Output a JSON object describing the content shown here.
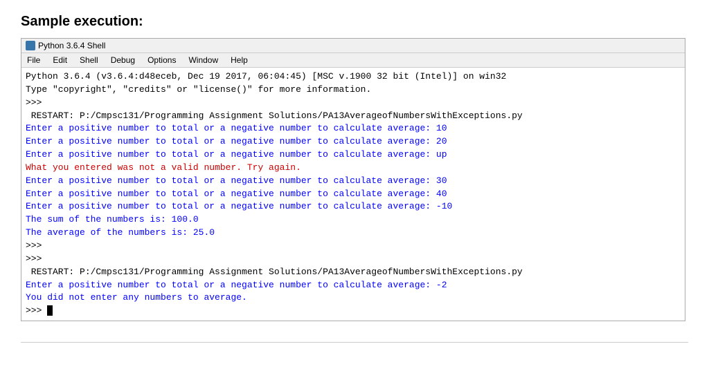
{
  "heading": "Sample execution:",
  "titleBar": {
    "icon": "python-icon",
    "label": "Python 3.6.4 Shell"
  },
  "menuBar": {
    "items": [
      "File",
      "Edit",
      "Shell",
      "Debug",
      "Options",
      "Window",
      "Help"
    ]
  },
  "shellLines": [
    {
      "type": "black",
      "text": "Python 3.6.4 (v3.6.4:d48eceb, Dec 19 2017, 06:04:45) [MSC v.1900 32 bit (Intel)] on win32"
    },
    {
      "type": "black",
      "text": "Type \"copyright\", \"credits\" or \"license()\" for more information."
    },
    {
      "type": "prompt",
      "text": ">>>"
    },
    {
      "type": "restart",
      "text": " RESTART: P:/Cmpsc131/Programming Assignment Solutions/PA13AverageofNumbersWithExceptions.py"
    },
    {
      "type": "blue",
      "text": "Enter a positive number to total or a negative number to calculate average: 10"
    },
    {
      "type": "blue",
      "text": "Enter a positive number to total or a negative number to calculate average: 20"
    },
    {
      "type": "blue",
      "text": "Enter a positive number to total or a negative number to calculate average: up"
    },
    {
      "type": "red",
      "text": "What you entered was not a valid number. Try again."
    },
    {
      "type": "blue",
      "text": "Enter a positive number to total or a negative number to calculate average: 30"
    },
    {
      "type": "blue",
      "text": "Enter a positive number to total or a negative number to calculate average: 40"
    },
    {
      "type": "blue",
      "text": "Enter a positive number to total or a negative number to calculate average: -10"
    },
    {
      "type": "blue",
      "text": "The sum of the numbers is: 100.0"
    },
    {
      "type": "blue",
      "text": "The average of the numbers is: 25.0"
    },
    {
      "type": "prompt",
      "text": ">>>"
    },
    {
      "type": "prompt",
      "text": ">>>"
    },
    {
      "type": "restart",
      "text": " RESTART: P:/Cmpsc131/Programming Assignment Solutions/PA13AverageofNumbersWithExceptions.py"
    },
    {
      "type": "blue",
      "text": "Enter a positive number to total or a negative number to calculate average: -2"
    },
    {
      "type": "blue",
      "text": "You did not enter any numbers to average."
    },
    {
      "type": "prompt-cursor",
      "text": ">>> "
    }
  ]
}
